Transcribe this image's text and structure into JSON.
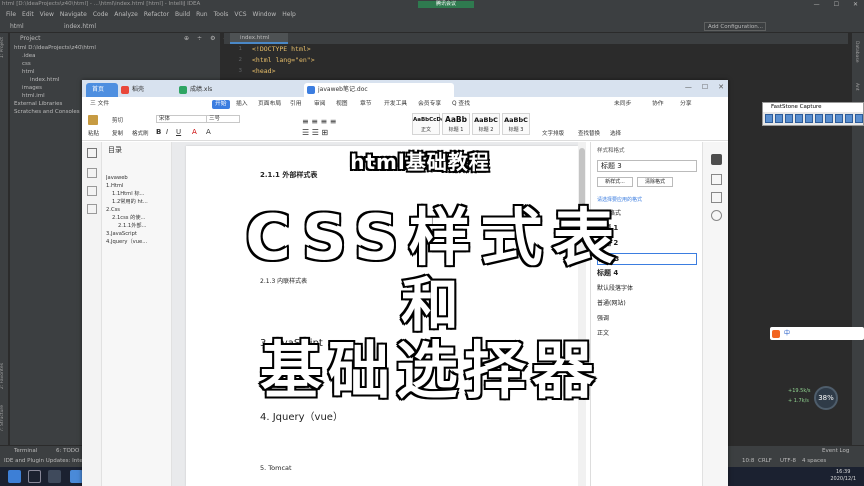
{
  "ide": {
    "title": "html [D:\\IdeaProjects\\z40\\html] - ...\\html\\index.html [html] - IntelliJ IDEA",
    "meeting": "腾讯会议",
    "menu": [
      "File",
      "Edit",
      "View",
      "Navigate",
      "Code",
      "Analyze",
      "Refactor",
      "Build",
      "Run",
      "Tools",
      "VCS",
      "Window",
      "Help"
    ],
    "breadcrumb": [
      "html",
      "index.html"
    ],
    "add_config": "Add Configuration...",
    "project_label": "Project",
    "tree": [
      {
        "label": "html  D:\\IdeaProjects\\z40\\html",
        "indent": 0
      },
      {
        "label": ".idea",
        "indent": 1
      },
      {
        "label": "css",
        "indent": 1
      },
      {
        "label": "html",
        "indent": 1
      },
      {
        "label": "index.html",
        "indent": 2
      },
      {
        "label": "images",
        "indent": 1
      },
      {
        "label": "html.iml",
        "indent": 1
      },
      {
        "label": "External Libraries",
        "indent": 0
      },
      {
        "label": "Scratches and Consoles",
        "indent": 0
      }
    ],
    "editor_tab": "index.html",
    "line_numbers": [
      "1",
      "2",
      "3"
    ],
    "code": [
      "<!DOCTYPE html>",
      "<html lang=\"en\">",
      "<head>"
    ],
    "left_strip": [
      "1: Project",
      "2: Favorites",
      "7: Structure"
    ],
    "right_strip": [
      "Database",
      "Ant"
    ],
    "bottom_tabs": [
      "Terminal",
      "6: TODO"
    ],
    "status_msg": "IDE and Plugin Updates: IntelliJ IDEA is ready to update. (2020/11/3 10:42)",
    "status_right": [
      "10:8",
      "CRLF",
      "UTF-8",
      "4 spaces"
    ],
    "event_log": "Event Log"
  },
  "taskbar": {
    "time": "16:39",
    "date": "2020/12/1"
  },
  "wps": {
    "tabs": {
      "home": "首页",
      "docer": "稻壳",
      "xls": "成绩.xls",
      "doc": "javaweb笔记.doc"
    },
    "ribbon_tabs": [
      "三 文件",
      "开始",
      "插入",
      "页面布局",
      "引用",
      "审阅",
      "视图",
      "章节",
      "开发工具",
      "会员专享",
      "Q 查找"
    ],
    "ribbon_right": [
      "未同步",
      "协作",
      "分享"
    ],
    "clipboard": [
      "粘贴",
      "剪切",
      "复制",
      "格式刷"
    ],
    "font_name": "宋体",
    "font_size": "三号",
    "styles": [
      {
        "preview": "AaBbCcDd",
        "name": "正文"
      },
      {
        "preview": "AaBb",
        "name": "标题 1"
      },
      {
        "preview": "AaBbC",
        "name": "标题 2"
      },
      {
        "preview": "AaBbC",
        "name": "标题 3"
      }
    ],
    "right_tools": [
      "文字排版",
      "查找替换",
      "选择"
    ],
    "toc_title": "目录",
    "toc": [
      {
        "label": "Javaweb",
        "indent": 0
      },
      {
        "label": "1.Html",
        "indent": 0
      },
      {
        "label": "1.1Html 标...",
        "indent": 1
      },
      {
        "label": "1.2常用的 ht...",
        "indent": 1
      },
      {
        "label": "2.Css",
        "indent": 0
      },
      {
        "label": "2.1css 的使...",
        "indent": 1
      },
      {
        "label": "2.1.1外部...",
        "indent": 2
      },
      {
        "label": "3.JavaScript",
        "indent": 0
      },
      {
        "label": "4.Jquery（vue...",
        "indent": 0
      }
    ],
    "doc": {
      "h211": "2.1.1  外部样式表",
      "h213": "2.1.3  内联样式表",
      "h3": "3.  JavaScript",
      "h4": "4.  Jquery（vue）",
      "h5": "5.  Tomcat"
    },
    "style_pane": {
      "title": "样式和格式",
      "current": "标题 3",
      "new_btn": "新样式...",
      "clear_btn": "清除格式",
      "section": "请选择要应用的格式",
      "items": [
        "清除格式",
        "标题 1",
        "标题 2",
        "标题 3",
        "标题 4",
        "默认段落字体",
        "普通(网站)",
        "强调",
        "正文"
      ]
    }
  },
  "overlay": {
    "subtitle": "html基础教程",
    "line1": "CSS样式表",
    "line2": "和",
    "line3": "基础选择器"
  },
  "faststone": {
    "title": "FastStone Capture"
  },
  "ime": {
    "label": "中"
  },
  "net": {
    "up": "+19.5k/s",
    "down": "+ 1.7k/s",
    "pct": "38%"
  }
}
